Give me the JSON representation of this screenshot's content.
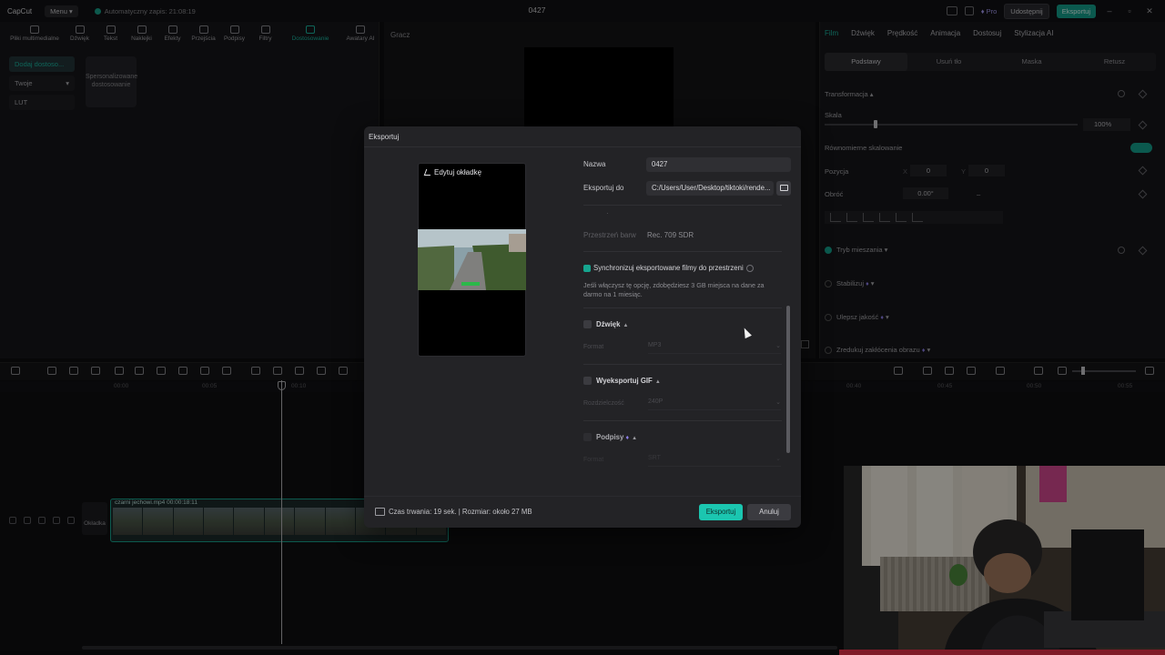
{
  "topbar": {
    "logo": "CapCut",
    "menu": "Menu",
    "autosave": "Automatyczny zapis: 21:08:19",
    "project_title": "0427",
    "pro": "Pro",
    "share": "Udostępnij",
    "export": "Eksportuj"
  },
  "tools": {
    "tabs": [
      "Pliki multimedialne",
      "Dźwięk",
      "Tekst",
      "Naklejki",
      "Efekty",
      "Przejścia",
      "Podpisy",
      "Filtry",
      "Dostosowanie",
      "Awatary AI"
    ],
    "active_tab": "Dostosowanie",
    "categories": [
      "Dodaj dostoso...",
      "Twoje",
      "LUT"
    ],
    "custom_card": "Spersonalizowane dostosowanie"
  },
  "player": {
    "label": "Gracz"
  },
  "props": {
    "tabs": [
      "Film",
      "Dźwięk",
      "Prędkość",
      "Animacja",
      "Dostosuj",
      "Stylizacja AI"
    ],
    "subtabs": [
      "Podstawy",
      "Usuń tło",
      "Maska",
      "Retusz"
    ],
    "transform": "Transformacja",
    "scale": "Skala",
    "scale_value": "100%",
    "uniform_scale": "Równomierne skalowanie",
    "position": "Pozycja",
    "pos_x_label": "X",
    "pos_x": "0",
    "pos_y_label": "Y",
    "pos_y": "0",
    "rotate": "Obróć",
    "rotate_value": "0.00°",
    "rotate_dash": "–",
    "blend": "Tryb mieszania",
    "stabilize": "Stabilizuj",
    "enhance": "Ulepsz jakość",
    "denoise": "Zredukuj zakłócenia obrazu"
  },
  "timeline": {
    "ruler": [
      "00:00",
      "00:05",
      "00:10",
      "00:40",
      "00:45",
      "00:50",
      "00:55"
    ],
    "cover": "Okładka",
    "clip_label": "czarni jechowi.mp4   00:00:18:11"
  },
  "dialog": {
    "title": "Eksportuj",
    "edit_cover": "Edytuj okładkę",
    "name_label": "Nazwa",
    "name_value": "0427",
    "export_to_label": "Eksportuj do",
    "export_to_value": "C:/Users/User/Desktop/tiktoki/rende...",
    "color_space_label": "Przestrzeń barw",
    "color_space_value": "Rec. 709 SDR",
    "sync_label": "Synchronizuj eksportowane filmy do przestrzeni",
    "sync_desc": "Jeśli włączysz tę opcję, zdobędziesz 3 GB miejsca na dane za darmo na 1 miesiąc.",
    "audio_label": "Dźwięk",
    "audio_sub": "Format",
    "audio_value": "MP3",
    "gif_label": "Wyeksportuj GIF",
    "gif_sub": "Rozdzielczość",
    "gif_value": "240P",
    "captions_label": "Podpisy",
    "captions_sub": "Format",
    "captions_value": "SRT",
    "duration": "Czas trwania: 19 sek. | Rozmiar: około 27 MB",
    "export_btn": "Eksportuj",
    "cancel_btn": "Anuluj"
  },
  "colors": {
    "accent": "#1bc6b0",
    "brand_teal": "#14a38e",
    "pro_purple": "#a69bf2"
  }
}
